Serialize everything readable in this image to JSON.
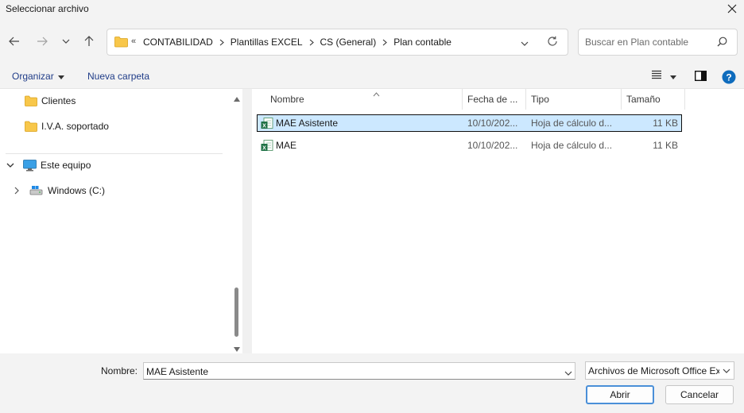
{
  "window": {
    "title": "Seleccionar archivo"
  },
  "address": {
    "overflow": "«",
    "crumbs": [
      "CONTABILIDAD",
      "Plantillas EXCEL",
      "CS (General)",
      "Plan contable"
    ]
  },
  "search": {
    "placeholder": "Buscar en Plan contable"
  },
  "toolbar": {
    "organizar": "Organizar",
    "nueva_carpeta": "Nueva carpeta"
  },
  "nav": {
    "items": [
      {
        "label": "Clientes",
        "icon": "folder-icon"
      },
      {
        "label": "I.V.A. soportado",
        "icon": "folder-icon"
      },
      {
        "label": "Este equipo",
        "icon": "computer-icon"
      },
      {
        "label": "Windows (C:)",
        "icon": "drive-icon"
      }
    ]
  },
  "columns": {
    "nombre": "Nombre",
    "fecha": "Fecha de ...",
    "tipo": "Tipo",
    "tamano": "Tamaño"
  },
  "files": [
    {
      "name": "MAE Asistente",
      "date": "10/10/202...",
      "type": "Hoja de cálculo d...",
      "size": "11 KB",
      "selected": true
    },
    {
      "name": "MAE",
      "date": "10/10/202...",
      "type": "Hoja de cálculo d...",
      "size": "11 KB",
      "selected": false
    }
  ],
  "footer": {
    "name_label": "Nombre:",
    "name_value": "MAE Asistente",
    "filetype": "Archivos de Microsoft Office Excel",
    "open": "Abrir",
    "cancel": "Cancelar"
  },
  "colors": {
    "link": "#1f3c88",
    "selection": "#cce8ff",
    "folder": "#f8c74a",
    "excel": "#1e7145",
    "help": "#0f6cbd"
  }
}
